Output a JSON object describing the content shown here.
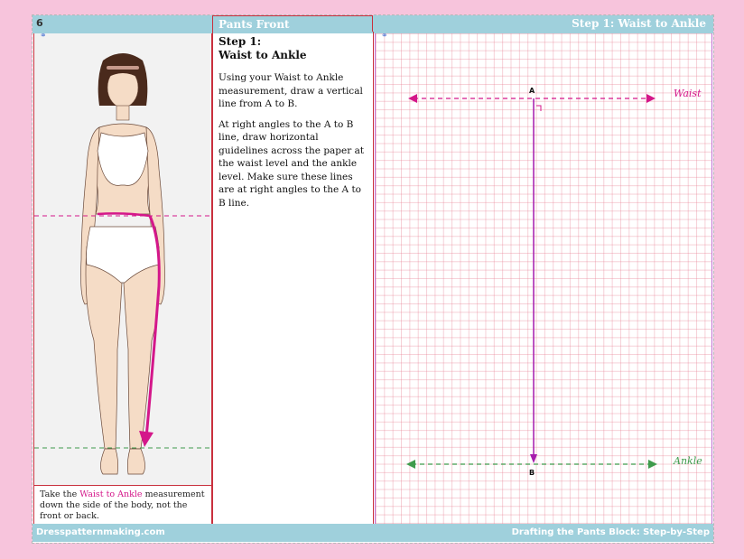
{
  "header": {
    "page_number": "6",
    "center_title": "Pants Front",
    "right_title": "Step 1: Waist to Ankle"
  },
  "footer": {
    "left": "Dresspatternmaking.com",
    "right": "Drafting the Pants Block: Step-by-Step"
  },
  "figure_caption": {
    "before": "Take the ",
    "highlight": "Waist to Ankle",
    "after": " measurement down the side of the body, not the front or back."
  },
  "instructions": {
    "step_line1": "Step 1:",
    "step_line2": "Waist to Ankle",
    "paragraph1": "Using your Waist to Ankle measurement, draw a vertical line from A to B.",
    "paragraph2": "At right angles to the A to B line, draw horizontal guidelines across the paper at the waist level and the ankle level.  Make sure these lines are at right angles to the A to B line."
  },
  "diagram": {
    "point_a": "A",
    "point_b": "B",
    "waist_label": "Waist",
    "ankle_label": "Ankle"
  },
  "colors": {
    "magenta": "#d4178a",
    "green": "#3f9b4c",
    "bar": "#9fd0dc",
    "border_red": "#c9303e"
  }
}
